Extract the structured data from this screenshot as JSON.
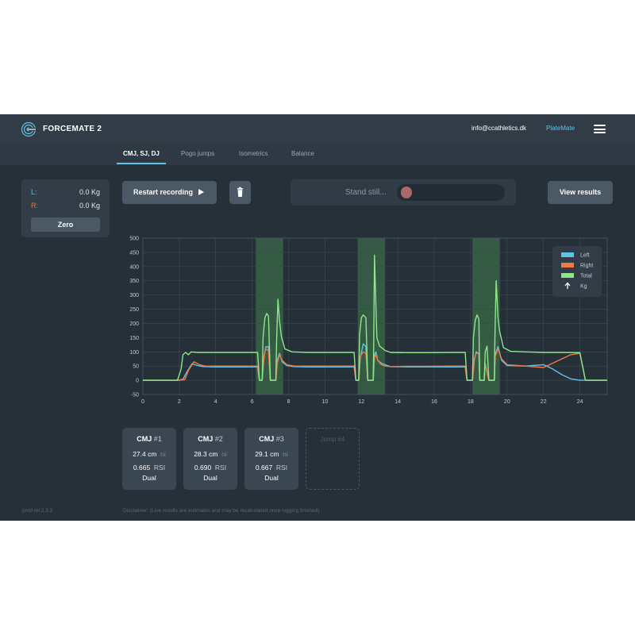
{
  "header": {
    "brand": "FORCEMATE 2",
    "email": "info@ccathletics.dk",
    "platemate": "PlateMate"
  },
  "tabs": [
    {
      "label": "CMJ, SJ, DJ",
      "active": true
    },
    {
      "label": "Pogo jumps",
      "active": false
    },
    {
      "label": "Isometrics",
      "active": false
    },
    {
      "label": "Balance",
      "active": false
    }
  ],
  "lr": {
    "left_label": "L:",
    "left_value": "0.0 Kg",
    "right_label": "R:",
    "right_value": "0.0 Kg",
    "zero_label": "Zero"
  },
  "controls": {
    "restart_label": "Restart recording",
    "status_text": "Stand still...",
    "view_results_label": "View results"
  },
  "colors": {
    "left": "#5fc3e8",
    "right": "#ee7a45",
    "total": "#8ee68a",
    "accent": "#5fc3e8"
  },
  "chart_data": {
    "type": "line",
    "x_ticks": [
      0,
      2,
      4,
      6,
      8,
      10,
      12,
      14,
      16,
      18,
      20,
      22,
      24
    ],
    "y_ticks": [
      -50,
      0,
      50,
      100,
      150,
      200,
      250,
      300,
      350,
      400,
      450,
      500
    ],
    "xlim": [
      0,
      25.5
    ],
    "ylim": [
      -50,
      500
    ],
    "grid": true,
    "legend": {
      "placement": "top-right",
      "entries": [
        "Left",
        "Right",
        "Total",
        "Kg"
      ]
    },
    "highlights": [
      [
        6.2,
        7.7
      ],
      [
        11.8,
        13.3
      ],
      [
        18.1,
        19.6
      ]
    ],
    "series": [
      {
        "name": "Left",
        "points": [
          [
            0,
            0
          ],
          [
            1.9,
            0
          ],
          [
            2.2,
            3
          ],
          [
            2.4,
            28
          ],
          [
            2.7,
            58
          ],
          [
            3.0,
            52
          ],
          [
            3.3,
            48
          ],
          [
            4.0,
            47
          ],
          [
            5.0,
            47
          ],
          [
            6.0,
            47
          ],
          [
            6.3,
            47
          ],
          [
            6.4,
            0
          ],
          [
            6.55,
            0
          ],
          [
            6.65,
            80
          ],
          [
            6.75,
            118
          ],
          [
            6.9,
            118
          ],
          [
            7.0,
            0
          ],
          [
            7.3,
            0
          ],
          [
            7.38,
            70
          ],
          [
            7.5,
            95
          ],
          [
            7.65,
            65
          ],
          [
            7.9,
            52
          ],
          [
            8.3,
            48
          ],
          [
            9,
            47
          ],
          [
            10,
            47
          ],
          [
            11,
            47
          ],
          [
            11.6,
            47
          ],
          [
            11.7,
            0
          ],
          [
            11.85,
            0
          ],
          [
            11.95,
            80
          ],
          [
            12.1,
            128
          ],
          [
            12.25,
            118
          ],
          [
            12.35,
            0
          ],
          [
            12.65,
            0
          ],
          [
            12.72,
            90
          ],
          [
            12.8,
            100
          ],
          [
            12.9,
            70
          ],
          [
            13.1,
            60
          ],
          [
            13.3,
            55
          ],
          [
            13.6,
            48
          ],
          [
            14.5,
            47
          ],
          [
            15.5,
            47
          ],
          [
            17,
            47
          ],
          [
            17.7,
            47
          ],
          [
            17.8,
            0
          ],
          [
            18.1,
            0
          ],
          [
            18.2,
            70
          ],
          [
            18.3,
            100
          ],
          [
            18.45,
            95
          ],
          [
            18.5,
            0
          ],
          [
            18.75,
            0
          ],
          [
            18.8,
            60
          ],
          [
            19.0,
            0
          ],
          [
            19.3,
            0
          ],
          [
            19.35,
            90
          ],
          [
            19.5,
            118
          ],
          [
            19.7,
            70
          ],
          [
            20.0,
            52
          ],
          [
            21.0,
            50
          ],
          [
            22.0,
            55
          ],
          [
            22.5,
            40
          ],
          [
            23.0,
            20
          ],
          [
            23.5,
            5
          ],
          [
            24.0,
            0
          ],
          [
            25.5,
            0
          ]
        ]
      },
      {
        "name": "Right",
        "points": [
          [
            0,
            0
          ],
          [
            2.0,
            0
          ],
          [
            2.3,
            2
          ],
          [
            2.5,
            35
          ],
          [
            2.8,
            65
          ],
          [
            3.1,
            55
          ],
          [
            3.4,
            50
          ],
          [
            4.0,
            50
          ],
          [
            5.0,
            50
          ],
          [
            6.0,
            50
          ],
          [
            6.3,
            50
          ],
          [
            6.4,
            0
          ],
          [
            6.55,
            0
          ],
          [
            6.65,
            85
          ],
          [
            6.75,
            110
          ],
          [
            6.9,
            105
          ],
          [
            7.0,
            0
          ],
          [
            7.3,
            0
          ],
          [
            7.38,
            60
          ],
          [
            7.5,
            90
          ],
          [
            7.65,
            70
          ],
          [
            7.9,
            55
          ],
          [
            8.3,
            50
          ],
          [
            9,
            50
          ],
          [
            10,
            50
          ],
          [
            11,
            50
          ],
          [
            11.6,
            50
          ],
          [
            11.7,
            0
          ],
          [
            11.85,
            0
          ],
          [
            11.95,
            85
          ],
          [
            12.1,
            100
          ],
          [
            12.25,
            95
          ],
          [
            12.35,
            0
          ],
          [
            12.65,
            0
          ],
          [
            12.72,
            80
          ],
          [
            12.8,
            90
          ],
          [
            12.9,
            70
          ],
          [
            13.1,
            55
          ],
          [
            13.3,
            50
          ],
          [
            13.6,
            48
          ],
          [
            14.5,
            49
          ],
          [
            15.5,
            49
          ],
          [
            17,
            50
          ],
          [
            17.7,
            50
          ],
          [
            17.8,
            0
          ],
          [
            18.1,
            0
          ],
          [
            18.2,
            75
          ],
          [
            18.3,
            95
          ],
          [
            18.45,
            95
          ],
          [
            18.5,
            0
          ],
          [
            18.75,
            0
          ],
          [
            18.8,
            55
          ],
          [
            19.0,
            0
          ],
          [
            19.3,
            0
          ],
          [
            19.35,
            85
          ],
          [
            19.5,
            110
          ],
          [
            19.7,
            75
          ],
          [
            20.0,
            55
          ],
          [
            21.0,
            50
          ],
          [
            22.0,
            45
          ],
          [
            22.5,
            60
          ],
          [
            23.0,
            75
          ],
          [
            23.5,
            90
          ],
          [
            24.0,
            95
          ],
          [
            24.3,
            0
          ],
          [
            25.5,
            0
          ]
        ]
      },
      {
        "name": "Total",
        "points": [
          [
            0,
            0
          ],
          [
            1.9,
            0
          ],
          [
            2.1,
            40
          ],
          [
            2.2,
            90
          ],
          [
            2.35,
            98
          ],
          [
            2.5,
            90
          ],
          [
            2.65,
            100
          ],
          [
            3.0,
            98
          ],
          [
            4.0,
            98
          ],
          [
            5.0,
            98
          ],
          [
            6.0,
            98
          ],
          [
            6.3,
            98
          ],
          [
            6.4,
            0
          ],
          [
            6.55,
            0
          ],
          [
            6.6,
            150
          ],
          [
            6.7,
            220
          ],
          [
            6.8,
            235
          ],
          [
            6.9,
            225
          ],
          [
            7.0,
            0
          ],
          [
            7.3,
            0
          ],
          [
            7.35,
            150
          ],
          [
            7.42,
            285
          ],
          [
            7.5,
            210
          ],
          [
            7.6,
            155
          ],
          [
            7.8,
            110
          ],
          [
            8.2,
            100
          ],
          [
            9,
            98
          ],
          [
            10,
            98
          ],
          [
            11,
            98
          ],
          [
            11.6,
            98
          ],
          [
            11.7,
            0
          ],
          [
            11.85,
            0
          ],
          [
            11.9,
            160
          ],
          [
            12.0,
            220
          ],
          [
            12.1,
            230
          ],
          [
            12.25,
            220
          ],
          [
            12.35,
            0
          ],
          [
            12.65,
            0
          ],
          [
            12.68,
            150
          ],
          [
            12.72,
            440
          ],
          [
            12.78,
            300
          ],
          [
            12.85,
            150
          ],
          [
            13.0,
            120
          ],
          [
            13.3,
            105
          ],
          [
            13.6,
            98
          ],
          [
            14.5,
            97
          ],
          [
            15.5,
            97
          ],
          [
            17,
            98
          ],
          [
            17.7,
            98
          ],
          [
            17.8,
            0
          ],
          [
            18.1,
            0
          ],
          [
            18.15,
            150
          ],
          [
            18.25,
            210
          ],
          [
            18.35,
            230
          ],
          [
            18.45,
            215
          ],
          [
            18.5,
            0
          ],
          [
            18.75,
            0
          ],
          [
            18.8,
            100
          ],
          [
            18.9,
            120
          ],
          [
            19.0,
            0
          ],
          [
            19.3,
            0
          ],
          [
            19.33,
            150
          ],
          [
            19.4,
            350
          ],
          [
            19.5,
            220
          ],
          [
            19.6,
            170
          ],
          [
            19.8,
            115
          ],
          [
            20.2,
            102
          ],
          [
            21.0,
            100
          ],
          [
            22.0,
            98
          ],
          [
            23.0,
            98
          ],
          [
            24.0,
            97
          ],
          [
            24.3,
            0
          ],
          [
            25.5,
            0
          ]
        ]
      }
    ]
  },
  "jumps": [
    {
      "title": "CMJ",
      "num": "#1",
      "height": "27.4 cm",
      "height_note": "ni",
      "rsi": "0.665",
      "rsi_label": "RSI",
      "mode": "Dual"
    },
    {
      "title": "CMJ",
      "num": "#2",
      "height": "28.3 cm",
      "height_note": "ni",
      "rsi": "0.690",
      "rsi_label": "RSI",
      "mode": "Dual"
    },
    {
      "title": "CMJ",
      "num": "#3",
      "height": "29.1 cm",
      "height_note": "ni",
      "rsi": "0.667",
      "rsi_label": "RSI",
      "mode": "Dual"
    }
  ],
  "jump_placeholder": "Jump #4",
  "footer": {
    "version": "prod rel 2.3.3",
    "disclaimer": "Disclaimer: (Live results are estimates and may be recalculated once logging finished)"
  }
}
